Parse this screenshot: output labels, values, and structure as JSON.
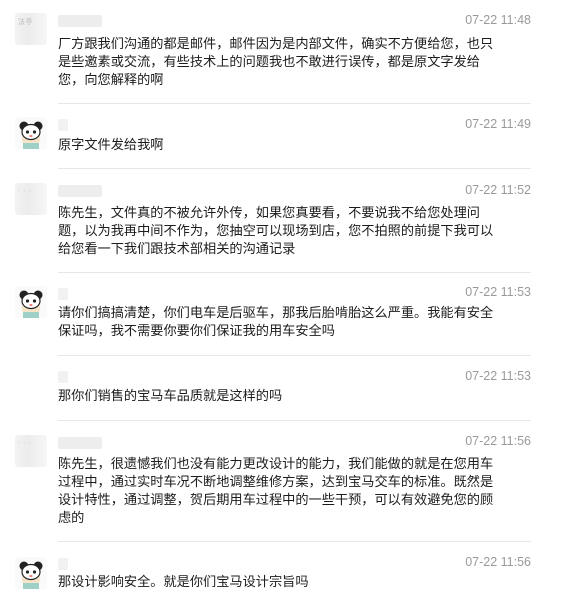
{
  "messages": [
    {
      "sender": "agent",
      "avatar_text": "法亭",
      "time": "07-22 11:48",
      "text": "厂方跟我们沟通的都是邮件，邮件因为是内部文件，确实不方便给您，也只\n是些邀素或交流，有些技术上的问题我也不敢进行误传，都是原文字发给\n您，向您解释的啊"
    },
    {
      "sender": "customer",
      "avatar_icon": "cartoon-avatar-icon",
      "time": "07-22 11:49",
      "text": "原字文件发给我啊"
    },
    {
      "sender": "agent",
      "time": "07-22 11:52",
      "text": "陈先生，文件真的不被允许外传，如果您真要看，不要说我不给您处理问\n题，以为我再中间不作为，您抽空可以现场到店，您不拍照的前提下我可以\n给您看一下我们跟技术部相关的沟通记录"
    },
    {
      "sender": "customer",
      "avatar_icon": "cartoon-avatar-icon",
      "time": "07-22 11:53",
      "text": "请你们搞搞清楚，你们电车是后驱车，那我后胎啃胎这么严重。我能有安全\n保证吗，我不需要你要你们保证我的用车安全吗"
    },
    {
      "sender": "customer",
      "time": "07-22 11:53",
      "text": "那你们销售的宝马车品质就是这样的吗"
    },
    {
      "sender": "agent",
      "time": "07-22 11:56",
      "text": "陈先生，很遗憾我们也没有能力更改设计的能力，我们能做的就是在您用车\n过程中，通过实时车况不断地调整维修方案，达到宝马交车的标准。既然是\n设计特性，通过调整，贺后期用车过程中的一些干预，可以有效避免您的顾\n虑的"
    },
    {
      "sender": "customer",
      "avatar_icon": "cartoon-avatar-icon",
      "time": "07-22 11:56",
      "text": "那设计影响安全。就是你们宝马设计宗旨吗"
    }
  ]
}
